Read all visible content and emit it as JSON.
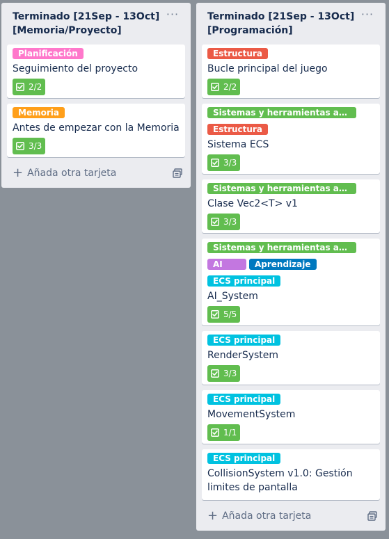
{
  "colors": {
    "board_bg": "#8a9199",
    "list_bg": "#ebecf0",
    "badge_green": "#61bd4f",
    "label_pink": "#ff78cb",
    "label_orange": "#ff9f1a",
    "label_red": "#eb5a46",
    "label_green": "#61bd4f",
    "label_purple": "#c377e0",
    "label_blue": "#0079bf",
    "label_sky": "#00c2e0"
  },
  "lists": [
    {
      "title": "Terminado [21Sep - 13Oct]\n[Memoria/Proyecto]",
      "menu": "···",
      "add_card": "Añada otra tarjeta",
      "cards": [
        {
          "labels": [
            {
              "text": "Planificación",
              "color": "#ff78cb"
            }
          ],
          "title": "Seguimiento del proyecto",
          "checklist": "2/2"
        },
        {
          "labels": [
            {
              "text": "Memoria",
              "color": "#ff9f1a"
            }
          ],
          "title": "Antes de empezar con la Memoria",
          "checklist": "3/3"
        }
      ]
    },
    {
      "title": "Terminado [21Sep - 13Oct]\n[Programación]",
      "menu": "···",
      "add_card": "Añada otra tarjeta",
      "cards": [
        {
          "labels": [
            {
              "text": "Estructura",
              "color": "#eb5a46"
            }
          ],
          "title": "Bucle principal del juego",
          "checklist": "2/2"
        },
        {
          "labels": [
            {
              "text": "Sistemas y herramientas auxiliares",
              "color": "#61bd4f"
            },
            {
              "text": "Estructura",
              "color": "#eb5a46"
            }
          ],
          "title": "Sistema ECS",
          "checklist": "3/3"
        },
        {
          "labels": [
            {
              "text": "Sistemas y herramientas auxiliares",
              "color": "#61bd4f"
            }
          ],
          "title": "Clase Vec2<T> v1",
          "checklist": "3/3"
        },
        {
          "labels": [
            {
              "text": "Sistemas y herramientas auxiliares",
              "color": "#61bd4f"
            },
            {
              "text": "AI",
              "color": "#c377e0"
            },
            {
              "text": "Aprendizaje",
              "color": "#0079bf"
            },
            {
              "text": "ECS principal",
              "color": "#00c2e0"
            }
          ],
          "title": "AI_System",
          "checklist": "5/5"
        },
        {
          "labels": [
            {
              "text": "ECS principal",
              "color": "#00c2e0"
            }
          ],
          "title": "RenderSystem",
          "checklist": "3/3"
        },
        {
          "labels": [
            {
              "text": "ECS principal",
              "color": "#00c2e0"
            }
          ],
          "title": "MovementSystem",
          "checklist": "1/1"
        },
        {
          "labels": [
            {
              "text": "ECS principal",
              "color": "#00c2e0"
            }
          ],
          "title": "CollisionSystem v1.0: Gestión limites de pantalla",
          "checklist": null
        }
      ]
    }
  ]
}
